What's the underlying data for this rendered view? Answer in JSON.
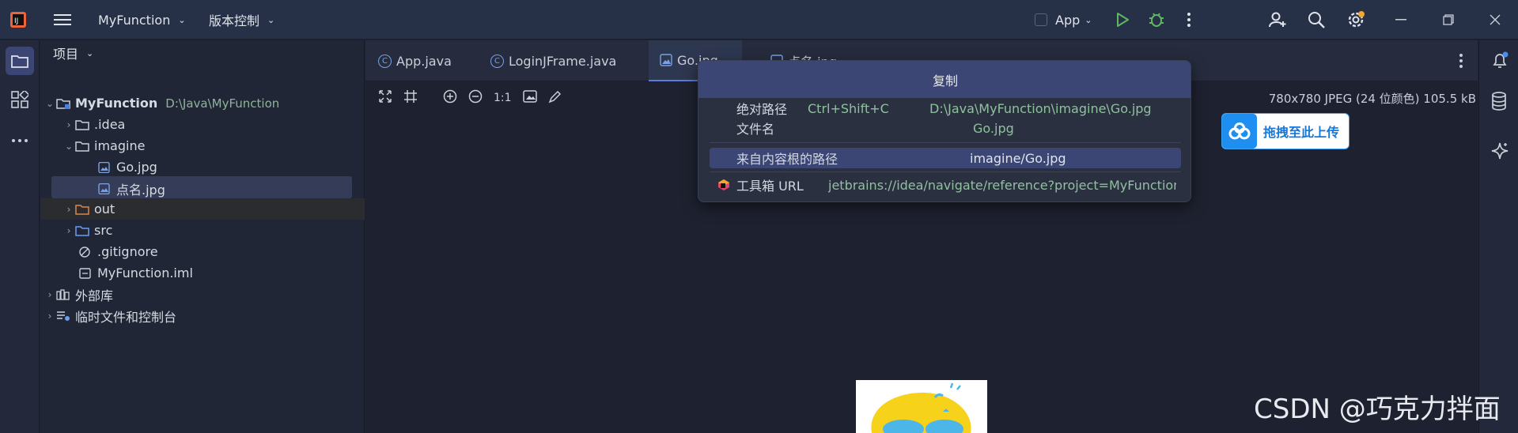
{
  "titlebar": {
    "project_name": "MyFunction",
    "vcs_label": "版本控制",
    "run_config": "App"
  },
  "project_panel": {
    "title": "项目",
    "items": [
      {
        "label": "MyFunction",
        "path": "D:\\Java\\MyFunction",
        "icon": "module-icon",
        "level": 0,
        "expanded": true
      },
      {
        "label": ".idea",
        "icon": "folder-icon",
        "level": 1,
        "expanded": false
      },
      {
        "label": "imagine",
        "icon": "folder-icon",
        "level": 1,
        "expanded": true
      },
      {
        "label": "Go.jpg",
        "icon": "image-file-icon",
        "level": 2
      },
      {
        "label": "点名.jpg",
        "icon": "image-file-icon",
        "level": 2,
        "selected": true
      },
      {
        "label": "out",
        "icon": "folder-orange-icon",
        "level": 1,
        "expanded": false
      },
      {
        "label": "src",
        "icon": "folder-blue-icon",
        "level": 1,
        "expanded": false
      },
      {
        "label": ".gitignore",
        "icon": "ignore-icon",
        "level": 1
      },
      {
        "label": "MyFunction.iml",
        "icon": "iml-icon",
        "level": 1
      },
      {
        "label": "外部库",
        "icon": "library-icon",
        "level": 0,
        "expanded": false
      },
      {
        "label": "临时文件和控制台",
        "icon": "scratch-icon",
        "level": 0,
        "expanded": false
      }
    ]
  },
  "tabs": [
    {
      "label": "App.java",
      "icon": "class-icon"
    },
    {
      "label": "LoginJFrame.java",
      "icon": "class-icon"
    },
    {
      "label": "Go.jpg",
      "icon": "image-file-icon",
      "active": true
    },
    {
      "label": "点名.jpg",
      "icon": "image-file-icon"
    }
  ],
  "image_info": "780x780 JPEG (24 位颜色) 105.5 kB",
  "image_toolbar": {
    "zoom_actual": "1:1"
  },
  "popup": {
    "title": "复制",
    "rows": [
      {
        "label": "绝对路径",
        "shortcut": "Ctrl+Shift+C",
        "value": "D:\\Java\\MyFunction\\imagine\\Go.jpg"
      },
      {
        "label": "文件名",
        "value": "Go.jpg"
      },
      {
        "label": "来自内容根的路径",
        "value": "imagine/Go.jpg",
        "selected": true
      },
      {
        "label": "工具箱 URL",
        "value": "jetbrains://idea/navigate/reference?project=MyFunction..."
      }
    ]
  },
  "upload_button": {
    "label": "拖拽至此上传"
  },
  "watermark": "CSDN @巧克力拌面",
  "colors": {
    "accent": "#3c4675",
    "path_green": "#8fc19e",
    "background": "#1e2230"
  }
}
